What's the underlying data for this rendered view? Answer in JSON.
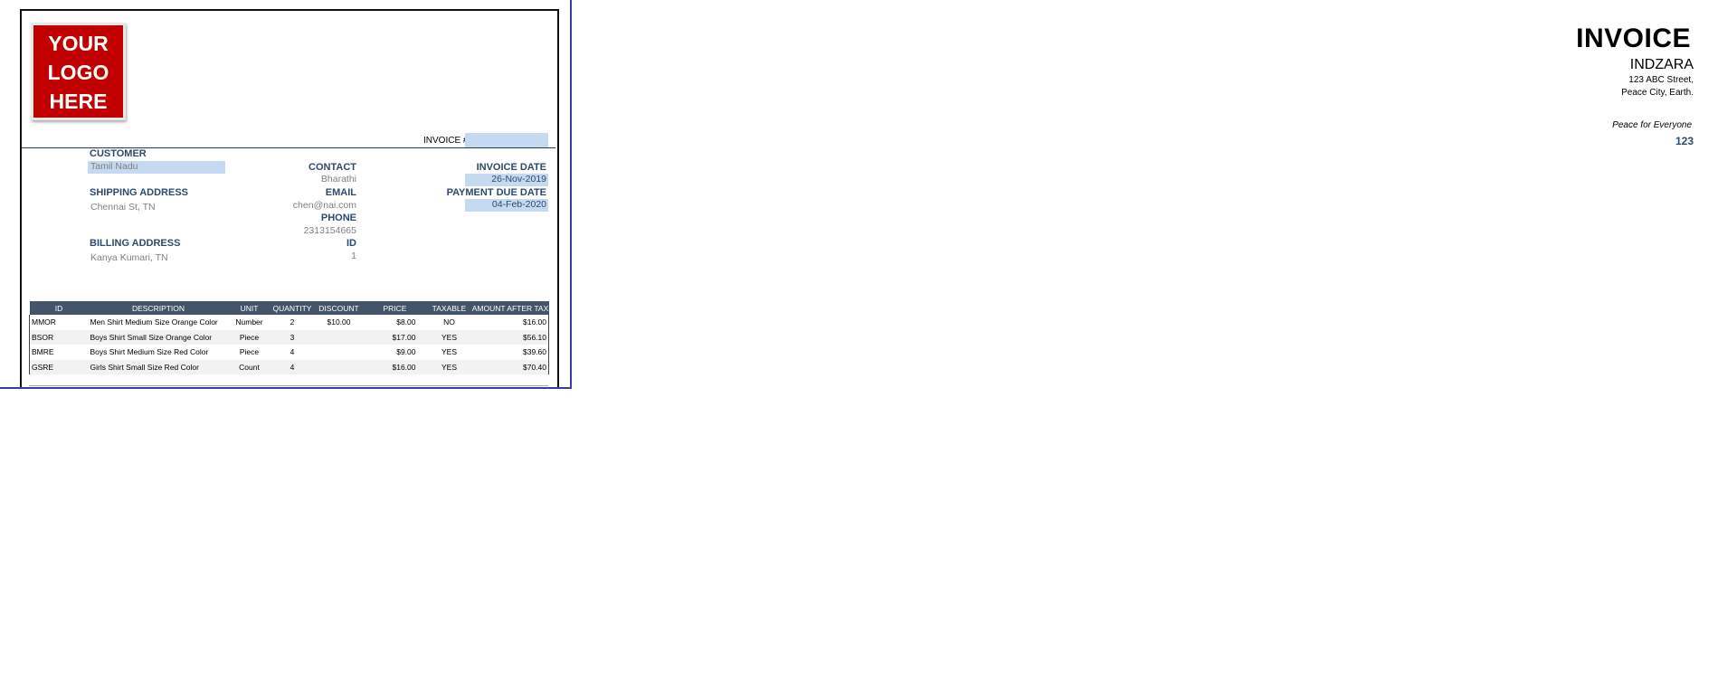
{
  "logo": {
    "text": "YOUR\nLOGO\nHERE"
  },
  "header": {
    "title": "INVOICE",
    "company": "INDZARA",
    "address_line1": "123 ABC Street,",
    "address_line2": "Peace City, Earth.",
    "tagline": "Peace for Everyone",
    "invoice_label": "INVOICE #",
    "invoice_number": "123"
  },
  "customer": {
    "label": "CUSTOMER",
    "value": "Tamil Nadu",
    "shipping_label": "SHIPPING ADDRESS",
    "shipping_value": "Chennai St, TN",
    "billing_label": "BILLING ADDRESS",
    "billing_value": "Kanya Kumari, TN"
  },
  "contact": {
    "contact_label": "CONTACT",
    "contact_value": "Bharathi",
    "email_label": "EMAIL",
    "email_value": "chen@nai.com",
    "phone_label": "PHONE",
    "phone_value": "2313154665",
    "id_label": "ID",
    "id_value": "1"
  },
  "dates": {
    "invoice_date_label": "INVOICE DATE",
    "invoice_date": "26-Nov-2019",
    "due_date_label": "PAYMENT DUE DATE",
    "due_date": "04-Feb-2020"
  },
  "items": {
    "headers": [
      "ID",
      "DESCRIPTION",
      "UNIT",
      "QUANTITY",
      "DISCOUNT",
      "PRICE",
      "TAXABLE",
      "AMOUNT AFTER TAX"
    ],
    "rows": [
      [
        "MMOR",
        "Men Shirt Medium Size Orange Color",
        "Number",
        "2",
        "$10.00",
        "$8.00",
        "NO",
        "$16.00"
      ],
      [
        "BSOR",
        "Boys Shirt Small Size Orange Color",
        "Piece",
        "3",
        "",
        "$17.00",
        "YES",
        "$56.10"
      ],
      [
        "BMRE",
        "Boys Shirt Medium Size Red Color",
        "Piece",
        "4",
        "",
        "$9.00",
        "YES",
        "$39.60"
      ],
      [
        "GSRE",
        "Girls Shirt Small Size Red Color",
        "Count",
        "4",
        "",
        "$16.00",
        "YES",
        "$70.40"
      ]
    ]
  },
  "colors": {
    "logo_bg": "#c00000",
    "header_text": "#2e4a6b",
    "highlight": "#c5d9f1",
    "table_header_bg": "#44546a"
  }
}
